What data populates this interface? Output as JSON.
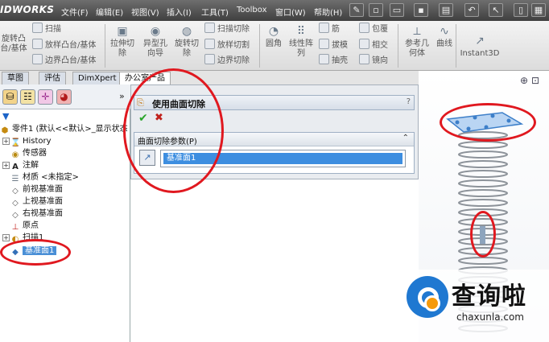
{
  "app": {
    "brand": "IDWORKS"
  },
  "menu": [
    "文件(F)",
    "编辑(E)",
    "视图(V)",
    "插入(I)",
    "工具(T)",
    "Toolbox",
    "窗口(W)",
    "帮助(H)"
  ],
  "quick_access_icons": [
    "pin-icon",
    "new-doc-icon",
    "open-icon",
    "save-icon",
    "print-icon",
    "undo-icon",
    "select-icon",
    "rebuild-icon",
    "options-icon"
  ],
  "ribbon": {
    "col1": [
      "旋转凸",
      "台/基体"
    ],
    "sweep": "扫描",
    "loft": "放样凸台/基体",
    "boundary": "边界凸台/基体",
    "extrude_cut": [
      "拉伸切",
      "除"
    ],
    "hole": [
      "异型孔",
      "向导"
    ],
    "revolve_cut": [
      "旋转切",
      "除"
    ],
    "sweep_cut": "扫描切除",
    "loft_cut": "放样切割",
    "boundary_cut": "边界切除",
    "fillet": "圆角",
    "linear_pattern": [
      "线性阵",
      "列"
    ],
    "rib": "筋",
    "draft": "拔模",
    "shell": "抽壳",
    "wrap": "包覆",
    "intersect": "相交",
    "mirror": "镜向",
    "ref_geometry": [
      "参考几",
      "何体"
    ],
    "curves": "曲线",
    "instant3d": "Instant3D"
  },
  "tabs": [
    "草图",
    "评估",
    "DimXpert",
    "办公室产品"
  ],
  "tree": {
    "root": "零件1  (默认<<默认>_显示状态",
    "items": [
      "History",
      "传感器",
      "注解",
      "材质 <未指定>",
      "前视基准面",
      "上视基准面",
      "右视基准面",
      "原点",
      "扫描1",
      "基准面1"
    ]
  },
  "property_manager": {
    "title": "使用曲面切除",
    "help": "?",
    "group_title": "曲面切除参数(P)",
    "selection": "基准面1"
  },
  "watermark": {
    "text": "查询啦",
    "url": "chaxunla.com"
  }
}
